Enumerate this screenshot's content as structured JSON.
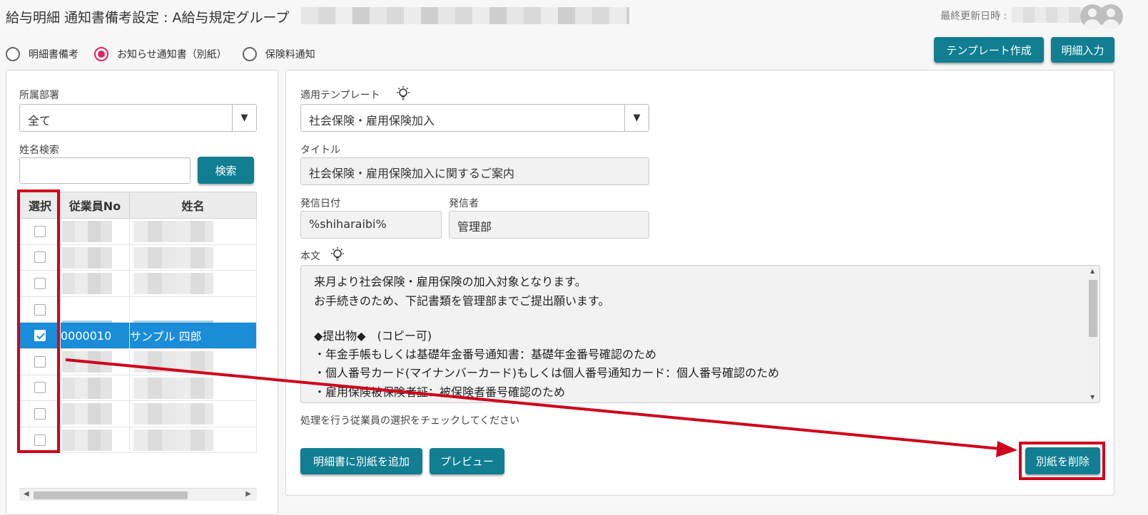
{
  "header": {
    "title": "給与明細 通知書備考設定 : A給与規定グループ",
    "last_updated_label": "最終更新日時 :"
  },
  "mode_radios": [
    {
      "label": "明細書備考",
      "selected": false
    },
    {
      "label": "お知らせ通知書（別紙）",
      "selected": true
    },
    {
      "label": "保険料通知",
      "selected": false
    }
  ],
  "top_buttons": {
    "template_create": "テンプレート作成",
    "detail_input": "明細入力"
  },
  "left_panel": {
    "department_label": "所属部署",
    "department_value": "全て",
    "name_search_label": "姓名検索",
    "search_input_value": "",
    "search_button": "検索",
    "table": {
      "headers": [
        "選択",
        "従業員No",
        "姓名"
      ],
      "rows": [
        {
          "checked": false,
          "emp_no": "",
          "name": ""
        },
        {
          "checked": false,
          "emp_no": "",
          "name": ""
        },
        {
          "checked": false,
          "emp_no": "",
          "name": ""
        },
        {
          "checked": false,
          "emp_no": "",
          "name": ""
        },
        {
          "checked": true,
          "emp_no": "0000010",
          "name": "サンプル 四郎"
        },
        {
          "checked": false,
          "emp_no": "",
          "name": ""
        },
        {
          "checked": false,
          "emp_no": "",
          "name": ""
        },
        {
          "checked": false,
          "emp_no": "",
          "name": ""
        },
        {
          "checked": false,
          "emp_no": "",
          "name": ""
        }
      ]
    }
  },
  "right_panel": {
    "template_label": "適用テンプレート",
    "template_value": "社会保険・雇用保険加入",
    "title_label": "タイトル",
    "title_value": "社会保険・雇用保険加入に関するご案内",
    "issue_date_label": "発信日付",
    "issue_date_value": "%shiharaibi%",
    "sender_label": "発信者",
    "sender_value": "管理部",
    "body_label": "本文",
    "body_lines": [
      "来月より社会保険・雇用保険の加入対象となります。",
      "お手続きのため、下記書類を管理部までご提出願います。",
      "",
      "◆提出物◆　(コピー可)",
      "・年金手帳もしくは基礎年金番号通知書：基礎年金番号確認のため",
      "・個人番号カード(マイナンバーカード)もしくは個人番号通知カード：個人番号確認のため",
      "・雇用保険被保険者証：被保険者番号確認のため"
    ],
    "instruction": "処理を行う従業員の選択をチェックしてください",
    "buttons": {
      "add_attachment": "明細書に別紙を追加",
      "preview": "プレビュー",
      "delete_attachment": "別紙を削除"
    }
  },
  "colors": {
    "primary_button": "#117e91",
    "selected_row": "#1a8cd8",
    "radio_accent": "#e0245e",
    "annotation_red": "#d0021b"
  }
}
